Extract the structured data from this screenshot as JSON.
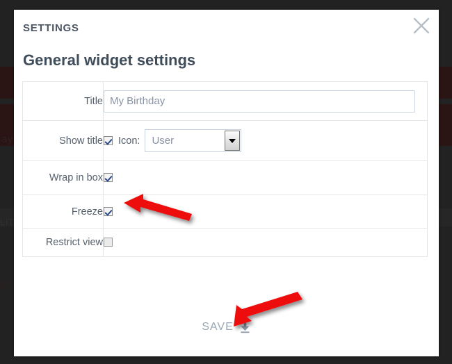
{
  "dialog": {
    "eyebrow": "SETTINGS",
    "title": "General widget settings",
    "close_icon": "close-icon"
  },
  "form": {
    "rows": [
      {
        "label": "Title",
        "type": "text"
      },
      {
        "label": "Show title",
        "type": "checkbox-with-select"
      },
      {
        "label": "Wrap in box",
        "type": "checkbox"
      },
      {
        "label": "Freeze",
        "type": "checkbox"
      },
      {
        "label": "Restrict view",
        "type": "checkbox"
      }
    ],
    "title_field": {
      "value": "My Birthday",
      "placeholder": "My Birthday"
    },
    "show_title": {
      "checked": true,
      "icon_label": "Icon:",
      "select_value": "User",
      "options": [
        "User"
      ]
    },
    "wrap_in_box": {
      "checked": true
    },
    "freeze": {
      "checked": true
    },
    "restrict_view": {
      "checked": false
    }
  },
  "footer": {
    "save_label": "SAVE",
    "save_icon": "download-icon"
  },
  "annotations": [
    {
      "name": "arrow-pointing-to-freeze-checkbox",
      "color": "#ee1111",
      "direction": "up-left"
    },
    {
      "name": "arrow-pointing-to-save-button",
      "color": "#ee1111",
      "direction": "down-left"
    }
  ],
  "colors": {
    "frame": "#1c1c1c",
    "dialog_bg": "#ffffff",
    "eyebrow_text": "#4c5763",
    "title_text": "#3f4c5a",
    "label_text": "#55606c",
    "input_text": "#8a93a5",
    "input_border": "#c7d3de",
    "table_border": "#e6e6e6",
    "save_text": "#9aa6b3",
    "arrow_red": "#ee1111"
  }
}
